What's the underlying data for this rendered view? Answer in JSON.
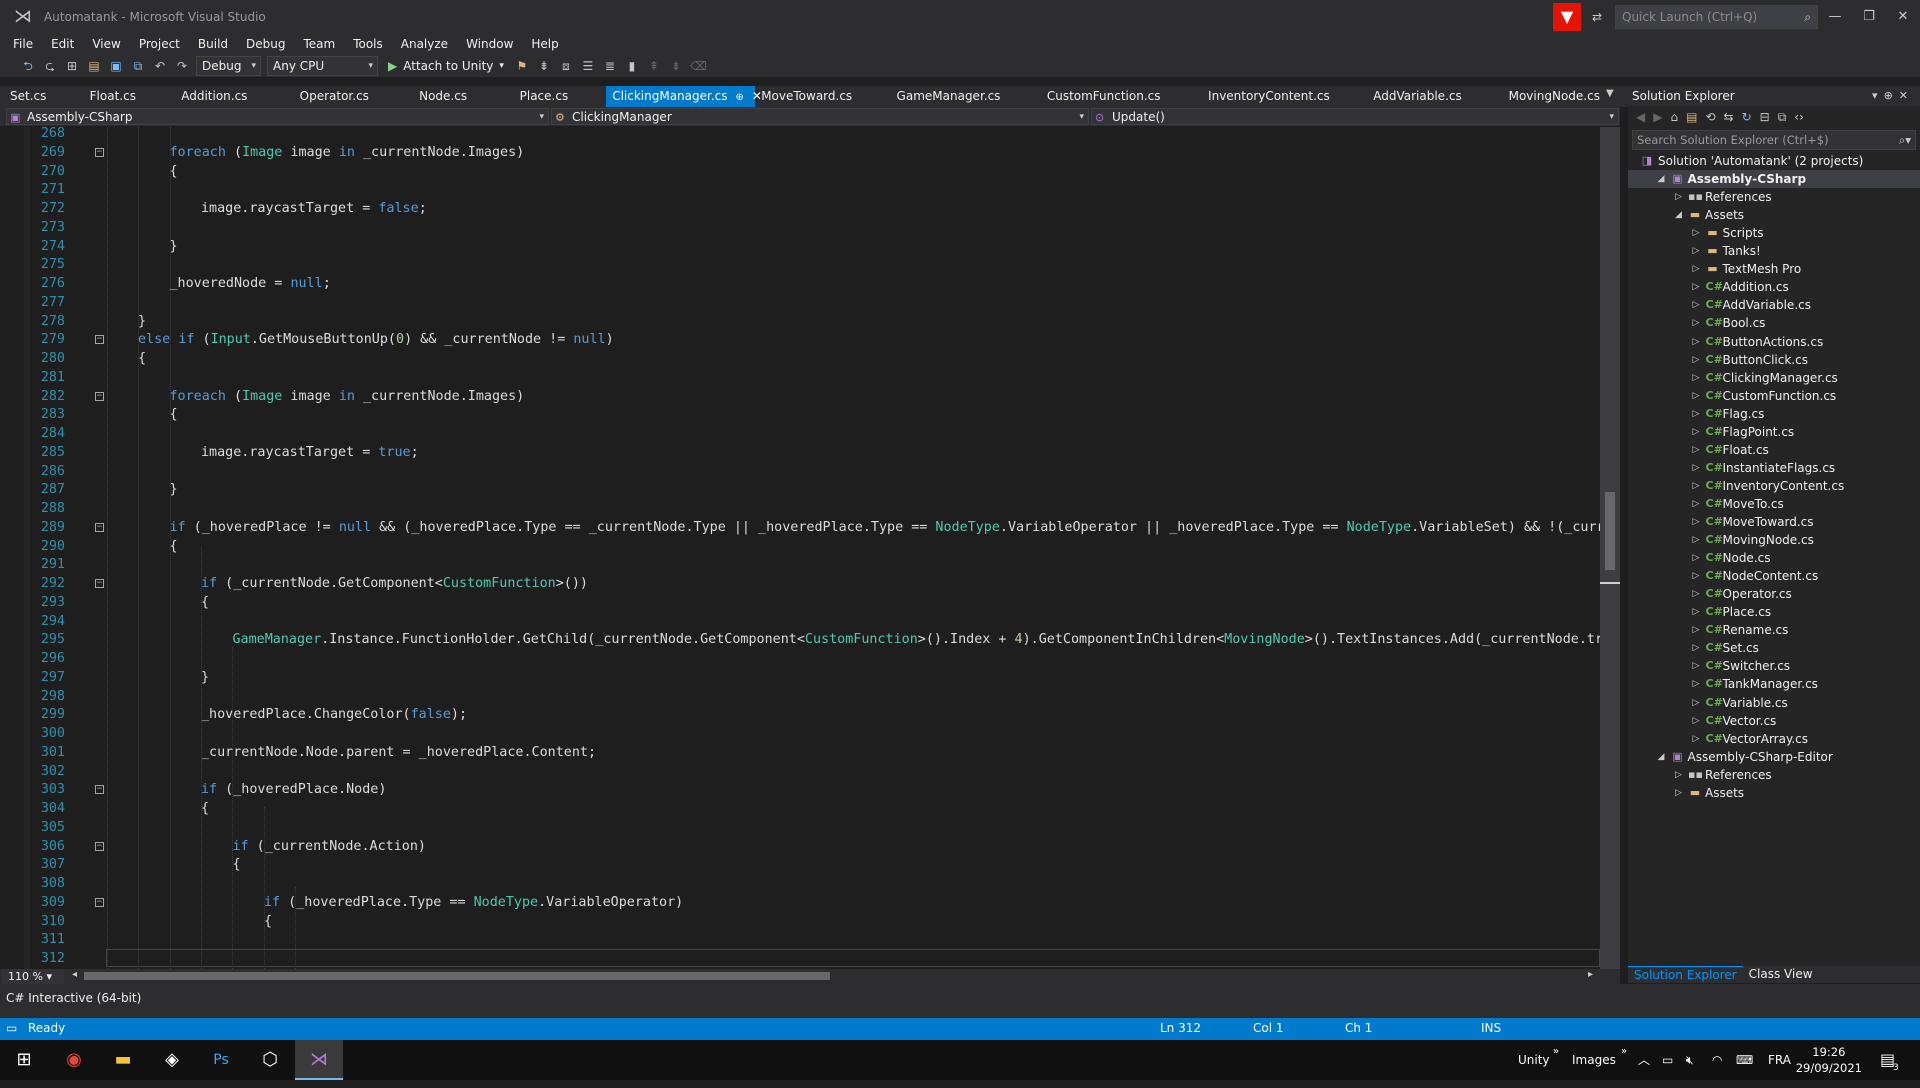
{
  "window": {
    "title": "Automatank - Microsoft Visual Studio",
    "quick_launch_placeholder": "Quick Launch (Ctrl+Q)"
  },
  "menu": [
    "File",
    "Edit",
    "View",
    "Project",
    "Build",
    "Debug",
    "Team",
    "Tools",
    "Analyze",
    "Window",
    "Help"
  ],
  "toolbar": {
    "config": "Debug",
    "platform": "Any CPU",
    "attach_label": "Attach to Unity"
  },
  "tabs": [
    "Set.cs",
    "Float.cs",
    "Addition.cs",
    "Operator.cs",
    "Node.cs",
    "Place.cs",
    "ClickingManager.cs",
    "MoveToward.cs",
    "GameManager.cs",
    "CustomFunction.cs",
    "InventoryContent.cs",
    "AddVariable.cs",
    "MovingNode.cs"
  ],
  "active_tab": "ClickingManager.cs",
  "navbar": {
    "project": "Assembly-CSharp",
    "class": "ClickingManager",
    "member": "Update()"
  },
  "code_lines": [
    {
      "n": "268",
      "t": ""
    },
    {
      "n": "269",
      "t": "foreach (Image image in _currentNode.Images)"
    },
    {
      "n": "270",
      "t": "{"
    },
    {
      "n": "271",
      "t": ""
    },
    {
      "n": "272",
      "t": "image.raycastTarget = false;"
    },
    {
      "n": "273",
      "t": ""
    },
    {
      "n": "274",
      "t": "}"
    },
    {
      "n": "275",
      "t": ""
    },
    {
      "n": "276",
      "t": "_hoveredNode = null;"
    },
    {
      "n": "277",
      "t": ""
    },
    {
      "n": "278",
      "t": "}"
    },
    {
      "n": "279",
      "t": "else if (Input.GetMouseButtonUp(0) && _currentNode != null)"
    },
    {
      "n": "280",
      "t": "{"
    },
    {
      "n": "281",
      "t": ""
    },
    {
      "n": "282",
      "t": "foreach (Image image in _currentNode.Images)"
    },
    {
      "n": "283",
      "t": "{"
    },
    {
      "n": "284",
      "t": ""
    },
    {
      "n": "285",
      "t": "image.raycastTarget = true;"
    },
    {
      "n": "286",
      "t": ""
    },
    {
      "n": "287",
      "t": "}"
    },
    {
      "n": "288",
      "t": ""
    },
    {
      "n": "289",
      "t": "if (_hoveredPlace != null && (_hoveredPlace.Type == _currentNode.Type || _hoveredPlace.Type == NodeType.VariableOperator || _hoveredPlace.Type == NodeType.VariableSet) && !(_curr"
    },
    {
      "n": "290",
      "t": "{"
    },
    {
      "n": "291",
      "t": ""
    },
    {
      "n": "292",
      "t": "if (_currentNode.GetComponent<CustomFunction>())"
    },
    {
      "n": "293",
      "t": "{"
    },
    {
      "n": "294",
      "t": ""
    },
    {
      "n": "295",
      "t": "GameManager.Instance.FunctionHolder.GetChild(_currentNode.GetComponent<CustomFunction>().Index + 4).GetComponentInChildren<MovingNode>().TextInstances.Add(_currentNode.tr"
    },
    {
      "n": "296",
      "t": ""
    },
    {
      "n": "297",
      "t": "}"
    },
    {
      "n": "298",
      "t": ""
    },
    {
      "n": "299",
      "t": "_hoveredPlace.ChangeColor(false);"
    },
    {
      "n": "300",
      "t": ""
    },
    {
      "n": "301",
      "t": "_currentNode.Node.parent = _hoveredPlace.Content;"
    },
    {
      "n": "302",
      "t": ""
    },
    {
      "n": "303",
      "t": "if (_hoveredPlace.Node)"
    },
    {
      "n": "304",
      "t": "{"
    },
    {
      "n": "305",
      "t": ""
    },
    {
      "n": "306",
      "t": "if (_currentNode.Action)"
    },
    {
      "n": "307",
      "t": "{"
    },
    {
      "n": "308",
      "t": ""
    },
    {
      "n": "309",
      "t": "if (_hoveredPlace.Type == NodeType.VariableOperator)"
    },
    {
      "n": "310",
      "t": "{"
    },
    {
      "n": "311",
      "t": ""
    },
    {
      "n": "312",
      "t": ""
    }
  ],
  "zoom": "110 %",
  "solution_explorer": {
    "title": "Solution Explorer",
    "search_placeholder": "Search Solution Explorer (Ctrl+$)",
    "items": [
      {
        "label": "Solution 'Automatank' (2 projects)",
        "kind": "solution"
      },
      {
        "label": "Assembly-CSharp",
        "kind": "project"
      },
      {
        "label": "References",
        "kind": "ref"
      },
      {
        "label": "Assets",
        "kind": "folder"
      },
      {
        "label": "Scripts",
        "kind": "folder"
      },
      {
        "label": "Tanks!",
        "kind": "folder"
      },
      {
        "label": "TextMesh Pro",
        "kind": "folder"
      },
      {
        "label": "Addition.cs",
        "kind": "cs"
      },
      {
        "label": "AddVariable.cs",
        "kind": "cs"
      },
      {
        "label": "Bool.cs",
        "kind": "cs"
      },
      {
        "label": "ButtonActions.cs",
        "kind": "cs"
      },
      {
        "label": "ButtonClick.cs",
        "kind": "cs"
      },
      {
        "label": "ClickingManager.cs",
        "kind": "cs"
      },
      {
        "label": "CustomFunction.cs",
        "kind": "cs"
      },
      {
        "label": "Flag.cs",
        "kind": "cs"
      },
      {
        "label": "FlagPoint.cs",
        "kind": "cs"
      },
      {
        "label": "Float.cs",
        "kind": "cs"
      },
      {
        "label": "InstantiateFlags.cs",
        "kind": "cs"
      },
      {
        "label": "InventoryContent.cs",
        "kind": "cs"
      },
      {
        "label": "MoveTo.cs",
        "kind": "cs"
      },
      {
        "label": "MoveToward.cs",
        "kind": "cs"
      },
      {
        "label": "MovingNode.cs",
        "kind": "cs"
      },
      {
        "label": "Node.cs",
        "kind": "cs"
      },
      {
        "label": "NodeContent.cs",
        "kind": "cs"
      },
      {
        "label": "Operator.cs",
        "kind": "cs"
      },
      {
        "label": "Place.cs",
        "kind": "cs"
      },
      {
        "label": "Rename.cs",
        "kind": "cs"
      },
      {
        "label": "Set.cs",
        "kind": "cs"
      },
      {
        "label": "Switcher.cs",
        "kind": "cs"
      },
      {
        "label": "TankManager.cs",
        "kind": "cs"
      },
      {
        "label": "Variable.cs",
        "kind": "cs"
      },
      {
        "label": "Vector.cs",
        "kind": "cs"
      },
      {
        "label": "VectorArray.cs",
        "kind": "cs"
      },
      {
        "label": "Assembly-CSharp-Editor",
        "kind": "project"
      },
      {
        "label": "References",
        "kind": "ref"
      },
      {
        "label": "Assets",
        "kind": "folder"
      }
    ],
    "bottom_tabs": [
      "Solution Explorer",
      "Class View"
    ]
  },
  "interactive_label": "C# Interactive (64-bit)",
  "status": {
    "ready": "Ready",
    "ln": "Ln 312",
    "col": "Col 1",
    "ch": "Ch 1",
    "ins": "INS"
  },
  "taskbar": {
    "unity": "Unity",
    "images": "Images",
    "lang": "FRA",
    "time": "19:26",
    "date": "29/09/2021",
    "notif_count": "3"
  },
  "colors": {
    "accent": "#007acc",
    "keyword": "#569cd6",
    "type": "#4ec9b0",
    "number": "#b5cea8",
    "linenum": "#2b91af"
  }
}
